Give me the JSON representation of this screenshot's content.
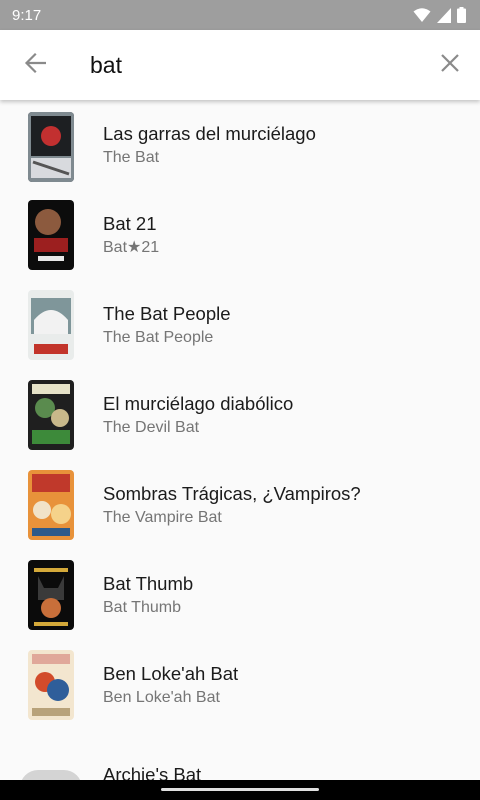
{
  "status_bar": {
    "time": "9:17",
    "icons": [
      "wifi-icon",
      "signal-icon",
      "battery-icon"
    ]
  },
  "search": {
    "query": "bat",
    "back_icon": "arrow-back-icon",
    "clear_icon": "close-icon"
  },
  "results": [
    {
      "title": "Las garras del murciélago",
      "subtitle": "The Bat"
    },
    {
      "title": "Bat 21",
      "subtitle": "Bat★21"
    },
    {
      "title": "The Bat People",
      "subtitle": "The Bat People"
    },
    {
      "title": "El murciélago diabólico",
      "subtitle": "The Devil Bat"
    },
    {
      "title": "Sombras Trágicas, ¿Vampiros?",
      "subtitle": "The Vampire Bat"
    },
    {
      "title": "Bat Thumb",
      "subtitle": "Bat Thumb"
    },
    {
      "title": "Ben Loke'ah Bat",
      "subtitle": "Ben Loke'ah Bat"
    },
    {
      "title": "Archie's Bat",
      "subtitle": ""
    }
  ],
  "colors": {
    "status_bar": "#9e9e9e",
    "background": "#fafafa",
    "title_text": "#1b1b1b",
    "subtitle_text": "#757575",
    "icon_gray": "#8a8a8a"
  }
}
